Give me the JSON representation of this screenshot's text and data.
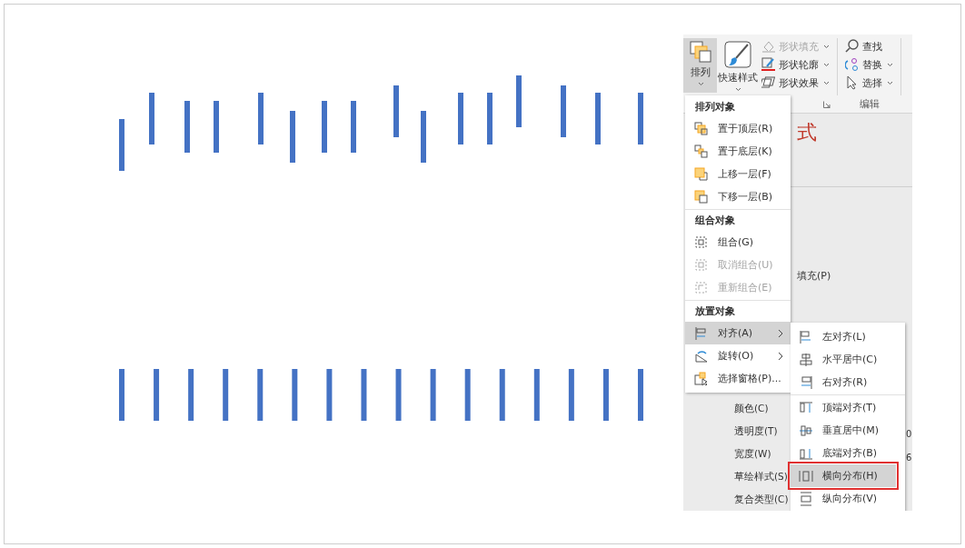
{
  "ribbon": {
    "big_buttons": [
      {
        "label": "排列",
        "kind": "arrange",
        "selected": true
      },
      {
        "label": "快速样式",
        "kind": "styles",
        "selected": false
      }
    ],
    "shape_commands": [
      {
        "label": "形状填充",
        "kind": "fill",
        "disabled": true
      },
      {
        "label": "形状轮廓",
        "kind": "outline",
        "disabled": false
      },
      {
        "label": "形状效果",
        "kind": "effects",
        "disabled": false
      }
    ],
    "edit_commands": [
      {
        "label": "查找",
        "kind": "find",
        "caret": false
      },
      {
        "label": "替换",
        "kind": "replace",
        "caret": true
      },
      {
        "label": "选择",
        "kind": "select",
        "caret": true
      }
    ],
    "edit_group_label": "编辑"
  },
  "format_pane": {
    "title_fragment": "式",
    "fill_fragment": "填充(P)",
    "line_labels": [
      "颜色(C)",
      "透明度(T)",
      "宽度(W)",
      "草绘样式(S)",
      "复合类型(C)"
    ],
    "value_fragments": [
      "0",
      "6"
    ]
  },
  "menu": {
    "sections": [
      {
        "header": "排列对象",
        "items": [
          {
            "label": "置于顶层(R)",
            "kind": "front",
            "disabled": false,
            "selected": false,
            "submenu": false
          },
          {
            "label": "置于底层(K)",
            "kind": "back",
            "disabled": false,
            "selected": false,
            "submenu": false
          },
          {
            "label": "上移一层(F)",
            "kind": "forward",
            "disabled": false,
            "selected": false,
            "submenu": false
          },
          {
            "label": "下移一层(B)",
            "kind": "backward",
            "disabled": false,
            "selected": false,
            "submenu": false
          }
        ]
      },
      {
        "header": "组合对象",
        "items": [
          {
            "label": "组合(G)",
            "kind": "group",
            "disabled": false,
            "selected": false,
            "submenu": false
          },
          {
            "label": "取消组合(U)",
            "kind": "ungroup",
            "disabled": true,
            "selected": false,
            "submenu": false
          },
          {
            "label": "重新组合(E)",
            "kind": "regroup",
            "disabled": true,
            "selected": false,
            "submenu": false
          }
        ]
      },
      {
        "header": "放置对象",
        "items": [
          {
            "label": "对齐(A)",
            "kind": "align",
            "disabled": false,
            "selected": true,
            "submenu": true
          },
          {
            "label": "旋转(O)",
            "kind": "rotate",
            "disabled": false,
            "selected": false,
            "submenu": true
          },
          {
            "label": "选择窗格(P)...",
            "kind": "pane",
            "disabled": false,
            "selected": false,
            "submenu": false
          }
        ]
      }
    ]
  },
  "submenu": {
    "groups": [
      [
        {
          "label": "左对齐(L)",
          "kind": "left",
          "selected": false,
          "annotated": false
        },
        {
          "label": "水平居中(C)",
          "kind": "hcenter",
          "selected": false,
          "annotated": false
        },
        {
          "label": "右对齐(R)",
          "kind": "right",
          "selected": false,
          "annotated": false
        }
      ],
      [
        {
          "label": "顶端对齐(T)",
          "kind": "top",
          "selected": false,
          "annotated": false
        },
        {
          "label": "垂直居中(M)",
          "kind": "vmiddle",
          "selected": false,
          "annotated": false
        },
        {
          "label": "底端对齐(B)",
          "kind": "bottom",
          "selected": false,
          "annotated": false
        },
        {
          "label": "横向分布(H)",
          "kind": "hdist",
          "selected": true,
          "annotated": true
        },
        {
          "label": "纵向分布(V)",
          "kind": "vdist",
          "selected": false,
          "annotated": false
        }
      ]
    ]
  }
}
